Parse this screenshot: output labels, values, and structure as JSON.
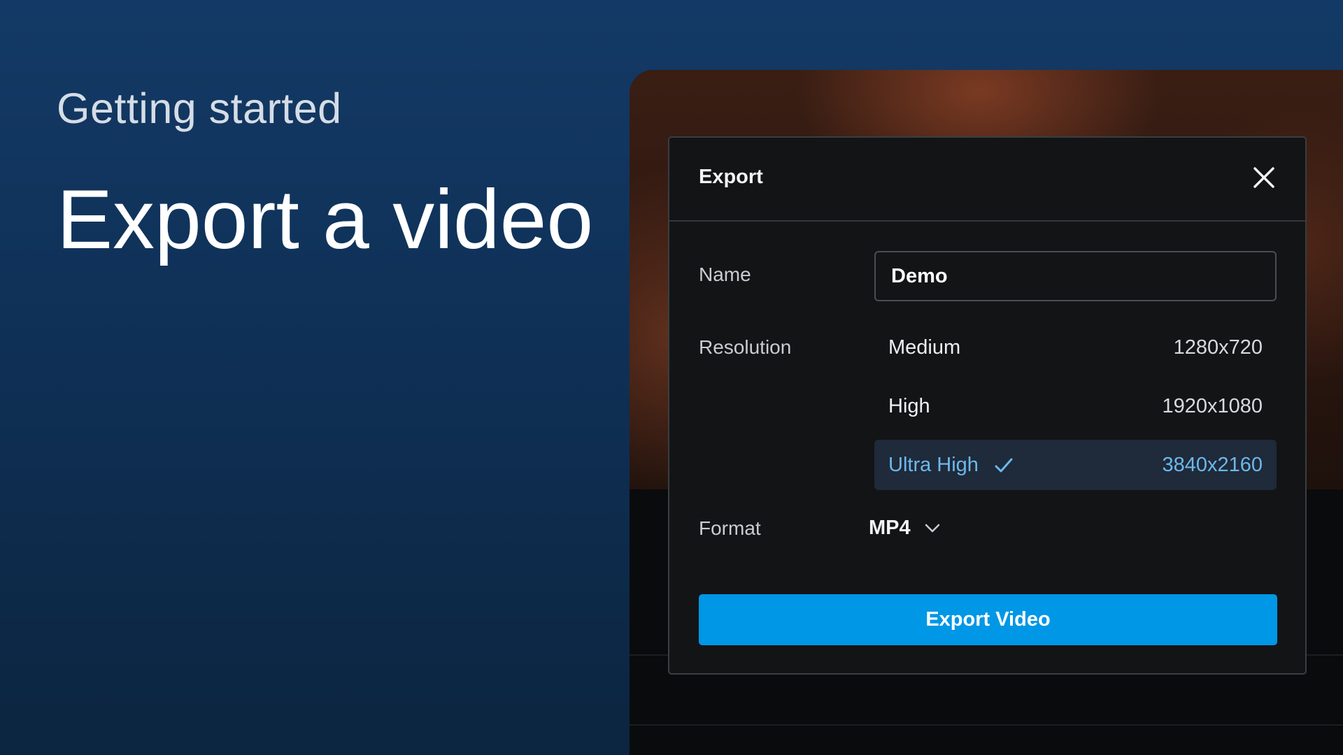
{
  "hero": {
    "eyebrow": "Getting started",
    "title": "Export a video"
  },
  "dialog": {
    "title": "Export",
    "close_icon": "close-icon",
    "name_label": "Name",
    "name_value": "Demo",
    "resolution_label": "Resolution",
    "resolutions": [
      {
        "name": "Medium",
        "value": "1280x720",
        "selected": false
      },
      {
        "name": "High",
        "value": "1920x1080",
        "selected": false
      },
      {
        "name": "Ultra High",
        "value": "3840x2160",
        "selected": true
      }
    ],
    "format_label": "Format",
    "format_value": "MP4",
    "format_icon": "chevron-down-icon",
    "export_button": "Export Video"
  },
  "colors": {
    "accent": "#0097e6",
    "selected_text": "#6cb8ec",
    "dialog_bg": "#131416"
  }
}
